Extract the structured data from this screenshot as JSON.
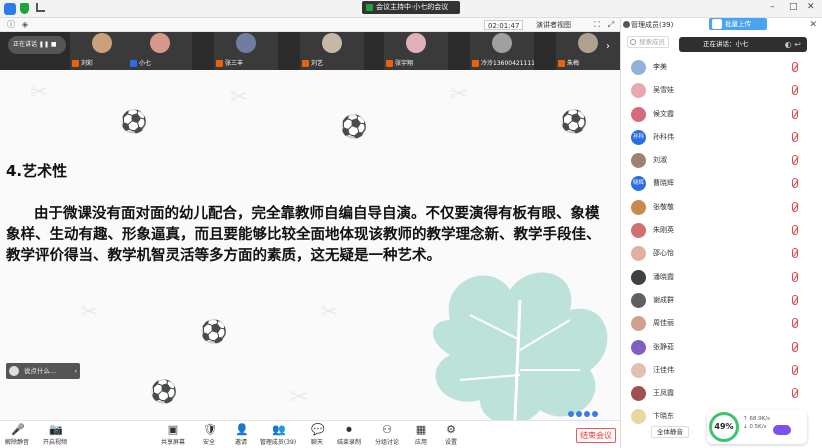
{
  "window": {
    "title": "会议主持中·小七的会议",
    "minimize": "–",
    "maximize": "□",
    "close": "✕"
  },
  "meetbar": {
    "timer": "02:01:47",
    "view_label": "演讲者视图"
  },
  "video_strip": {
    "control_label": "正在讲话",
    "tiles": [
      {
        "name": "刘彩",
        "blue": false,
        "color": "#c9a27b"
      },
      {
        "name": "小七",
        "blue": true,
        "color": "#d79a8a"
      },
      {
        "name": "张三丰",
        "blue": false,
        "color": "#6f7da0"
      },
      {
        "name": "刘艺",
        "blue": false,
        "color": "#c8b8a8"
      },
      {
        "name": "张宇翔",
        "blue": false,
        "color": "#e1b0b8"
      },
      {
        "name": "冷泠13600421111",
        "blue": false,
        "color": "#a0a0a0"
      },
      {
        "name": "朱梅",
        "blue": false,
        "color": "#b0a090"
      }
    ]
  },
  "slide": {
    "heading": "4.艺术性",
    "body": "由于微课没有面对面的幼儿配合，完全靠教师自编自导自演。不仅要演得有板有眼、象模象样、生动有趣、形象逼真，而且要能够比较全面地体现该教师的教学理念新、教学手段佳、教学评价得当、教学机智灵活等多方面的素质，这无疑是一种艺术。",
    "comment_placeholder": "说点什么..."
  },
  "toolbar": {
    "items": [
      {
        "label": "解除静音",
        "glyph": "🎤"
      },
      {
        "label": "开启视频",
        "glyph": "📷"
      },
      {
        "label": "共享屏幕",
        "glyph": "▣"
      },
      {
        "label": "安全",
        "glyph": "🛡"
      },
      {
        "label": "邀请",
        "glyph": "👤"
      },
      {
        "label": "管理成员(39)",
        "glyph": "👥"
      },
      {
        "label": "聊天",
        "glyph": "💬"
      },
      {
        "label": "结束录制",
        "glyph": "⏺"
      },
      {
        "label": "分组讨论",
        "glyph": "⚇"
      },
      {
        "label": "应用",
        "glyph": "▦"
      },
      {
        "label": "设置",
        "glyph": "⚙"
      }
    ],
    "end_label": "结束会议"
  },
  "panel": {
    "title": "管理成员(39)",
    "upload_label": "批量上传",
    "search_placeholder": "搜索成员",
    "speaking_label": "正在讲话：小七",
    "mute_all_label": "全体静音",
    "members": [
      {
        "name": "李美",
        "av": "",
        "color": "#8fb2d8"
      },
      {
        "name": "吴雪娃",
        "av": "",
        "color": "#e8a8b0"
      },
      {
        "name": "候文霞",
        "av": "",
        "color": "#d66a7a"
      },
      {
        "name": "孙科伟",
        "av": "孙科",
        "color": "#2b6de5"
      },
      {
        "name": "刘淑",
        "av": "",
        "color": "#a08070"
      },
      {
        "name": "曹晓辉",
        "av": "晓辉",
        "color": "#2b6de5"
      },
      {
        "name": "张敬敬",
        "av": "",
        "color": "#c98a50"
      },
      {
        "name": "朱刚英",
        "av": "",
        "color": "#d07070"
      },
      {
        "name": "邵心怡",
        "av": "",
        "color": "#e0b0a0"
      },
      {
        "name": "潘晓霞",
        "av": "",
        "color": "#404040"
      },
      {
        "name": "谢成群",
        "av": "",
        "color": "#606060"
      },
      {
        "name": "周佳丽",
        "av": "",
        "color": "#d0a090"
      },
      {
        "name": "张静茹",
        "av": "",
        "color": "#8060c0"
      },
      {
        "name": "汪佳伟",
        "av": "",
        "color": "#e0c0b0"
      },
      {
        "name": "王凤霞",
        "av": "",
        "color": "#a05050"
      },
      {
        "name": "卞晓东",
        "av": "",
        "color": "#e8d8a0"
      }
    ],
    "net": {
      "percent": "49%",
      "up": "↑ 68.9K/s",
      "down": "↓ 0.5K/s"
    }
  }
}
